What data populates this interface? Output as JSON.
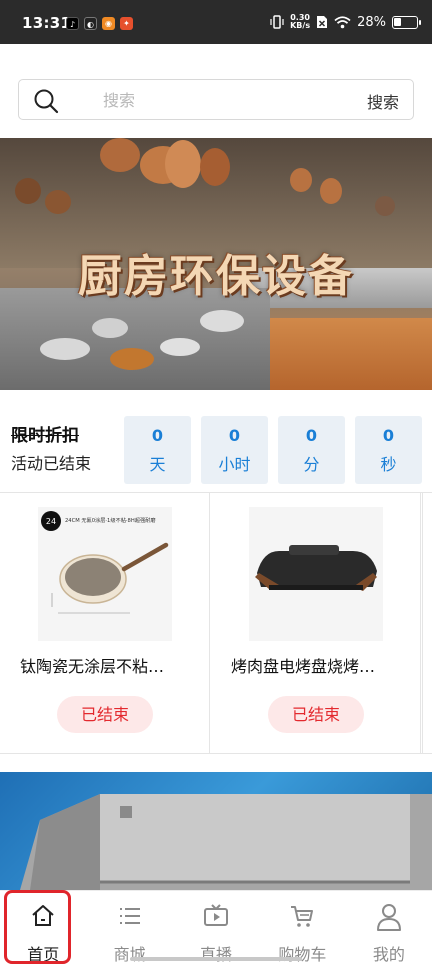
{
  "status_bar": {
    "time": "13:31",
    "net_speed_value": "0.30",
    "net_speed_unit": "KB/s",
    "battery": "28%"
  },
  "search": {
    "placeholder": "搜索",
    "button_label": "搜索"
  },
  "banner": {
    "title": "厨房环保设备"
  },
  "flash_sale": {
    "title": "限时折扣",
    "status": "活动已结束",
    "countdown": [
      {
        "value": "0",
        "unit": "天"
      },
      {
        "value": "0",
        "unit": "小时"
      },
      {
        "value": "0",
        "unit": "分"
      },
      {
        "value": "0",
        "unit": "秒"
      }
    ]
  },
  "products": [
    {
      "name": "钛陶瓷无涂层不粘…",
      "button": "已结束",
      "image_label": "24CM 无氟0涂层·1级不粘·8H超强耐磨"
    },
    {
      "name": "烤肉盘电烤盘烧烤…",
      "button": "已结束"
    }
  ],
  "bottom_nav": [
    {
      "label": "首页",
      "icon": "home-icon",
      "active": true
    },
    {
      "label": "商城",
      "icon": "list-icon",
      "active": false
    },
    {
      "label": "直播",
      "icon": "tv-icon",
      "active": false
    },
    {
      "label": "购物车",
      "icon": "cart-icon",
      "active": false
    },
    {
      "label": "我的",
      "icon": "user-icon",
      "active": false
    }
  ],
  "colors": {
    "accent_blue": "#1a7fd6",
    "ended_red": "#e3292e",
    "ended_bg": "#fde8e8",
    "highlight_frame": "#e0252b"
  }
}
